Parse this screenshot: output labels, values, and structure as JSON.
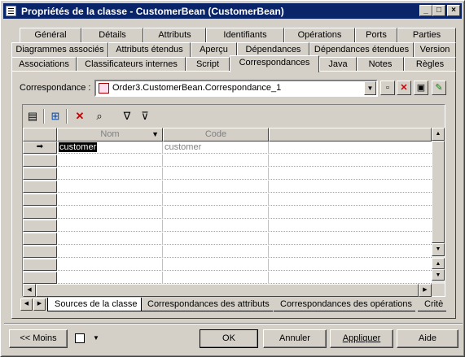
{
  "window": {
    "title": "Propriétés de la classe - CustomerBean (CustomerBean)",
    "controls": [
      "_",
      "□",
      "×"
    ]
  },
  "tabs": {
    "row1": [
      "Général",
      "Détails",
      "Attributs",
      "Identifiants",
      "Opérations",
      "Ports",
      "Parties"
    ],
    "row2": [
      "Diagrammes associés",
      "Attributs étendus",
      "Aperçu",
      "Dépendances",
      "Dépendances étendues",
      "Version"
    ],
    "row3": [
      "Associations",
      "Classificateurs internes",
      "Script",
      "Correspondances",
      "Java",
      "Notes",
      "Règles"
    ],
    "active": "Correspondances"
  },
  "correspondance": {
    "label": "Correspondance :",
    "value": "Order3.CustomerBean.Correspondance_1"
  },
  "toolbar": {
    "icons": [
      "properties-icon",
      "add-rows-icon",
      "delete-icon",
      "find-icon",
      "filter-icon",
      "filter-settings-icon"
    ]
  },
  "grid": {
    "columns": [
      "Nom",
      "Code"
    ],
    "rows": [
      {
        "marker": "➡",
        "nom": "customer",
        "code": "customer"
      }
    ],
    "empty_rows": 11
  },
  "subtabs": {
    "items": [
      "Sources de la classe",
      "Correspondances des attributs",
      "Correspondances des opérations",
      "Critè"
    ],
    "active": "Sources de la classe"
  },
  "footer": {
    "moins": "<< Moins",
    "ok": "OK",
    "annuler": "Annuler",
    "appliquer": "Appliquer",
    "aide": "Aide"
  }
}
